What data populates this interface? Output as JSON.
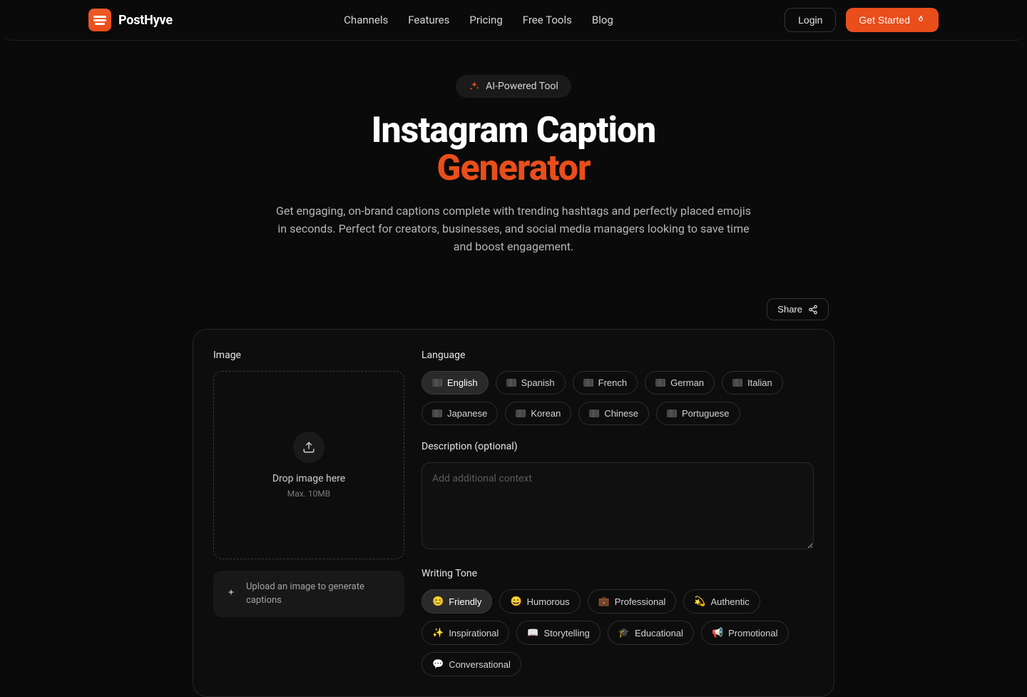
{
  "brand": {
    "name": "PostHyve"
  },
  "nav": {
    "channels": "Channels",
    "features": "Features",
    "pricing": "Pricing",
    "freetools": "Free Tools",
    "blog": "Blog"
  },
  "header": {
    "login": "Login",
    "get_started": "Get Started"
  },
  "hero": {
    "badge": "AI-Powered Tool",
    "title_line1": "Instagram Caption",
    "title_line2": "Generator",
    "subtitle": "Get engaging, on-brand captions complete with trending hashtags and perfectly placed emojis in seconds. Perfect for creators, businesses, and social media managers looking to save time and boost engagement."
  },
  "actions": {
    "share": "Share"
  },
  "panel": {
    "image_label": "Image",
    "dropzone_primary": "Drop image here",
    "dropzone_secondary": "Max. 10MB",
    "hint": "Upload an image to generate captions",
    "language_label": "Language",
    "languages": {
      "english": "English",
      "spanish": "Spanish",
      "french": "French",
      "german": "German",
      "italian": "Italian",
      "japanese": "Japanese",
      "korean": "Korean",
      "chinese": "Chinese",
      "portuguese": "Portuguese"
    },
    "description_label": "Description (optional)",
    "description_placeholder": "Add additional context",
    "tone_label": "Writing Tone",
    "tones": {
      "friendly": "Friendly",
      "humorous": "Humorous",
      "professional": "Professional",
      "authentic": "Authentic",
      "inspirational": "Inspirational",
      "storytelling": "Storytelling",
      "educational": "Educational",
      "promotional": "Promotional",
      "conversational": "Conversational"
    },
    "tone_emoji": {
      "friendly": "😊",
      "humorous": "😄",
      "professional": "💼",
      "authentic": "💫",
      "inspirational": "✨",
      "storytelling": "📖",
      "educational": "🎓",
      "promotional": "📢",
      "conversational": "💬"
    }
  },
  "colors": {
    "accent": "#e94e1b"
  }
}
